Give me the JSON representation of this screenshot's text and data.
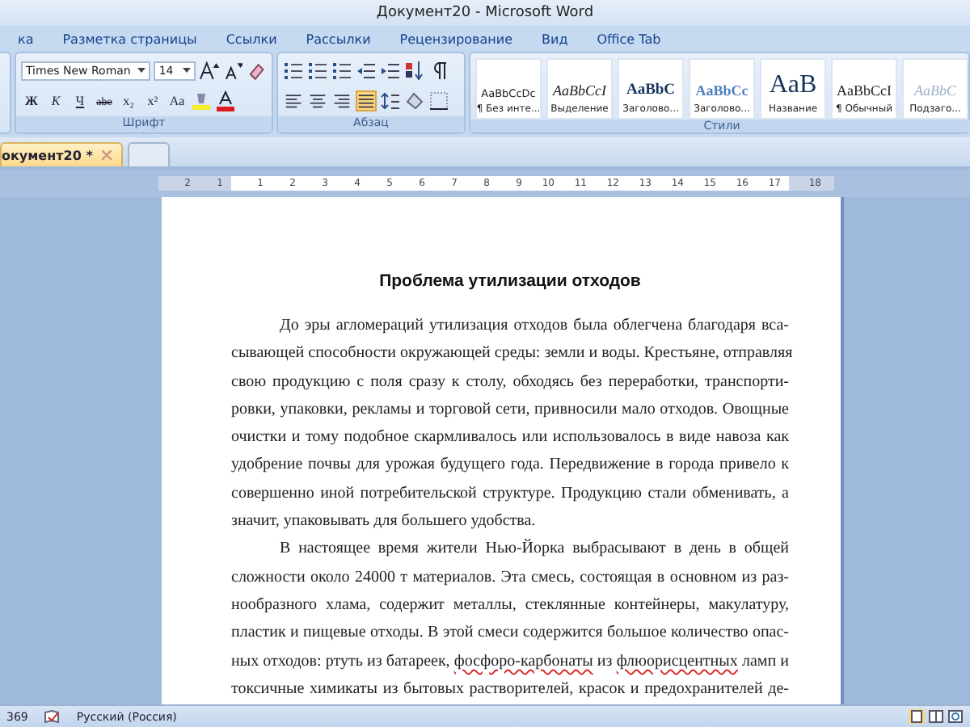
{
  "window": {
    "title": "Документ20 - Microsoft Word"
  },
  "ribbon_tabs": [
    {
      "label": "ка",
      "selected": false
    },
    {
      "label": "Разметка страницы",
      "selected": false
    },
    {
      "label": "Ссылки",
      "selected": false
    },
    {
      "label": "Рассылки",
      "selected": false
    },
    {
      "label": "Рецензирование",
      "selected": false
    },
    {
      "label": "Вид",
      "selected": false
    },
    {
      "label": "Office Tab",
      "selected": false
    }
  ],
  "font_group": {
    "label": "Шрифт",
    "font_name": "Times New Roman",
    "font_size": "14",
    "format_buttons": [
      {
        "label": "Ж",
        "kind": "bold"
      },
      {
        "label": "К",
        "kind": "italic"
      },
      {
        "label": "Ч",
        "kind": "underline"
      },
      {
        "label": "abe",
        "kind": "strike"
      },
      {
        "label": "x₂",
        "kind": "plain"
      },
      {
        "label": "x²",
        "kind": "plain"
      },
      {
        "label": "Aa",
        "kind": "plain"
      }
    ]
  },
  "paragraph_group": {
    "label": "Абзац",
    "alignments": [
      {
        "selected": false
      },
      {
        "selected": false
      },
      {
        "selected": false
      },
      {
        "selected": true
      }
    ]
  },
  "styles_group": {
    "label": "Стили",
    "items": [
      {
        "sample": "AaBbCcDc",
        "label": "¶ Без инте...",
        "kind": "plain"
      },
      {
        "sample": "AaBbCcI",
        "label": "Выделение",
        "kind": "emphasis"
      },
      {
        "sample": "AaBbC",
        "label": "Заголово...",
        "kind": "heading1"
      },
      {
        "sample": "AaBbCc",
        "label": "Заголово...",
        "kind": "heading2"
      },
      {
        "sample": "AaB",
        "label": "Название",
        "kind": "title"
      },
      {
        "sample": "AaBbCcI",
        "label": "¶ Обычный",
        "kind": "normal"
      },
      {
        "sample": "AaBbC",
        "label": "Подзаго...",
        "kind": "subtitle"
      }
    ]
  },
  "document_tabs": [
    {
      "label": "окумент20 *",
      "selected": true
    },
    {
      "selected": false
    }
  ],
  "ruler": {
    "left_labels": [
      "2",
      "1"
    ],
    "labels": [
      "1",
      "2",
      "3",
      "4",
      "5",
      "6",
      "7",
      "8",
      "9",
      "10",
      "11",
      "12",
      "13",
      "14",
      "15",
      "16",
      "17"
    ],
    "right_labels": [
      "18"
    ]
  },
  "document": {
    "heading": "Проблема утилизации отходов",
    "paragraphs": [
      {
        "lines": [
          [
            {
              "text": "До эры агломераций утилизация отходов была облегчена благодаря вса-",
              "misspelled": false
            }
          ],
          [
            {
              "text": "сывающей способности окружающей среды: земли и воды. Крестьяне, отправляя",
              "misspelled": false
            }
          ],
          [
            {
              "text": "свою продукцию с поля сразу к столу, обходясь без переработки, транспорти-",
              "misspelled": false
            }
          ],
          [
            {
              "text": "ровки, упаковки, рекламы и торговой сети, привносили мало отходов. Овощные",
              "misspelled": false
            }
          ],
          [
            {
              "text": "очистки и тому подобное скармливалось или использовалось в виде навоза как",
              "misspelled": false
            }
          ],
          [
            {
              "text": "удобрение почвы для урожая будущего года. Передвижение в города привело к",
              "misspelled": false
            }
          ],
          [
            {
              "text": "совершенно иной потребительской структуре. Продукцию стали обменивать, а",
              "misspelled": false
            }
          ],
          [
            {
              "text": "значит, упаковывать для большего удобства.",
              "misspelled": false
            }
          ]
        ]
      },
      {
        "lines": [
          [
            {
              "text": "В настоящее время жители Нью-Йорка выбрасывают в день в общей",
              "misspelled": false
            }
          ],
          [
            {
              "text": "сложности около 24000 т материалов. Эта смесь, состоящая в основном из раз-",
              "misspelled": false
            }
          ],
          [
            {
              "text": "нообразного хлама, содержит металлы, стеклянные контейнеры, макулатуру,",
              "misspelled": false
            }
          ],
          [
            {
              "text": "пластик и пищевые отходы. В этой смеси содержится большое количество опас-",
              "misspelled": false
            }
          ],
          [
            {
              "text": "ных отходов: ртуть из батареек, ",
              "misspelled": false
            },
            {
              "text": "фосфоро-карбонаты",
              "misspelled": true
            },
            {
              "text": " из ",
              "misspelled": false
            },
            {
              "text": "флюорисцентных",
              "misspelled": true
            },
            {
              "text": " ламп и",
              "misspelled": false
            }
          ],
          [
            {
              "text": "токсичные химикаты из бытовых растворителей, красок и предохранителей де-",
              "misspelled": false
            }
          ]
        ]
      }
    ]
  },
  "status_bar": {
    "word_count": "369",
    "language": "Русский (Россия)"
  }
}
